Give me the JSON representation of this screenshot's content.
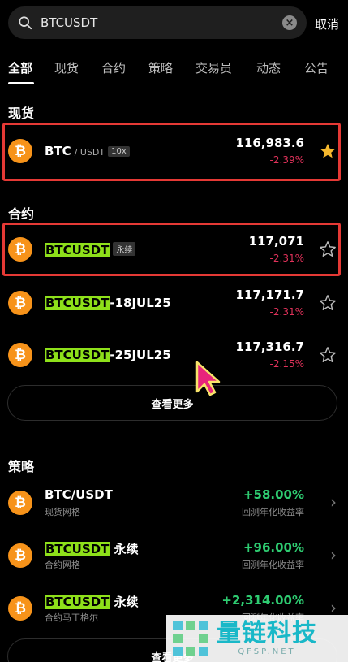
{
  "search": {
    "value": "BTCUSDT",
    "cancel_label": "取消"
  },
  "tabs": [
    {
      "label": "全部",
      "active": true
    },
    {
      "label": "现货"
    },
    {
      "label": "合约"
    },
    {
      "label": "策略"
    },
    {
      "label": "交易员"
    },
    {
      "label": "动态"
    },
    {
      "label": "公告"
    }
  ],
  "spot": {
    "title": "现货",
    "items": [
      {
        "coin_letter": "₿",
        "name": "BTC",
        "pair": "/ USDT",
        "tag": "10x",
        "price": "116,983.6",
        "change": "-2.39%",
        "favorited": true
      }
    ]
  },
  "futures": {
    "title": "合约",
    "items": [
      {
        "coin_letter": "₿",
        "highlight": "BTCUSDT",
        "suffix": "",
        "tag": "永续",
        "price": "117,071",
        "change": "-2.31%"
      },
      {
        "coin_letter": "₿",
        "highlight": "BTCUSDT",
        "suffix": "-18JUL25",
        "tag": "",
        "price": "117,171.7",
        "change": "-2.31%"
      },
      {
        "coin_letter": "₿",
        "highlight": "BTCUSDT",
        "suffix": "-25JUL25",
        "tag": "",
        "price": "117,316.7",
        "change": "-2.15%"
      }
    ],
    "more_label": "查看更多"
  },
  "strategy": {
    "title": "策略",
    "items": [
      {
        "coin_letter": "₿",
        "highlight": "",
        "name": "BTC/USDT",
        "subtitle": "现货网格",
        "pct": "+58.00%",
        "pct_label": "回测年化收益率"
      },
      {
        "coin_letter": "₿",
        "highlight": "BTCUSDT",
        "name": " 永续",
        "subtitle": "合约网格",
        "pct": "+96.00%",
        "pct_label": "回测年化收益率"
      },
      {
        "coin_letter": "₿",
        "highlight": "BTCUSDT",
        "name": " 永续",
        "subtitle": "合约马丁格尔",
        "pct": "+2,314.00%",
        "pct_label": "回测年化收益率"
      }
    ],
    "more_label": "查看更多"
  },
  "watermark": {
    "title": "量链科技",
    "url": "QFSP.NET"
  },
  "colors": {
    "negative": "#e0325a",
    "positive": "#2ecc71",
    "highlight": "#8ee01a",
    "bitcoin": "#f7931a",
    "favorite": "#f5b82e",
    "annotation": "#e53935"
  }
}
